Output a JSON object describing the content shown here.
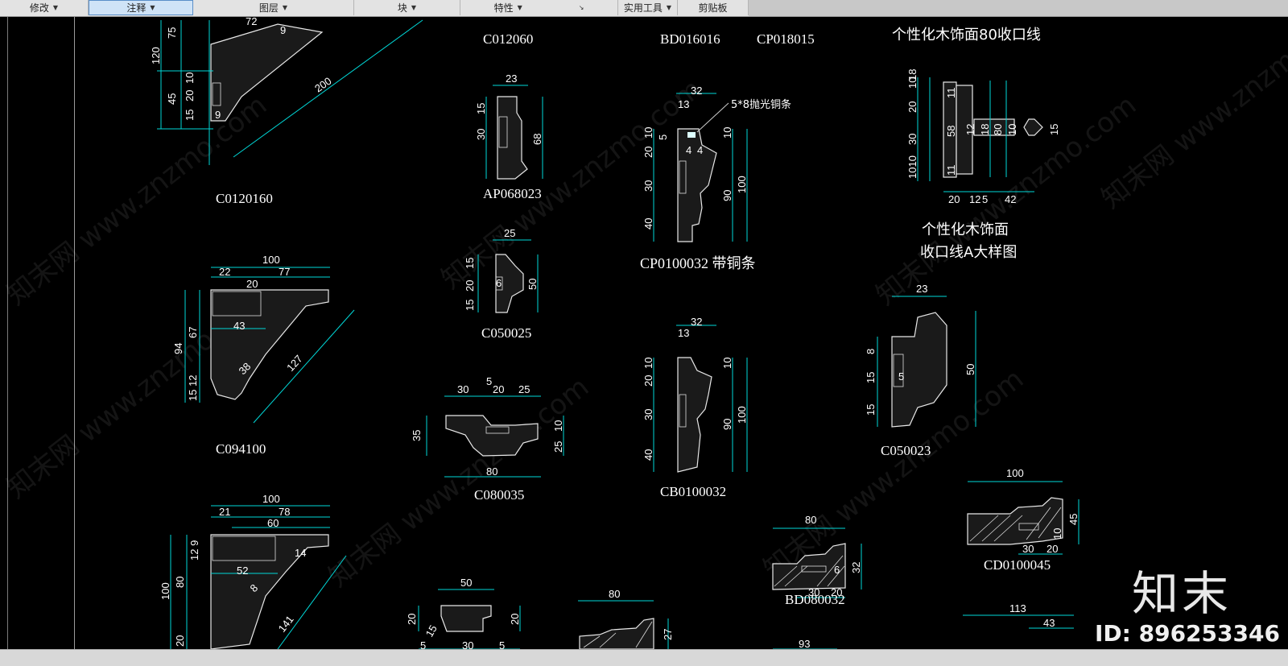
{
  "toolbar": {
    "groups": [
      {
        "label": "修改"
      },
      {
        "label": "注释"
      },
      {
        "label": "图层"
      },
      {
        "label": "块"
      },
      {
        "label": "特性"
      },
      {
        "label": "实用工具"
      },
      {
        "label": "剪贴板"
      }
    ]
  },
  "drawing": {
    "labels": {
      "c0120160": "C0120160",
      "c012060": "C012060",
      "bd016016": "BD016016",
      "cp018015": "CP018015",
      "title_80": "个性化木饰面80收口线",
      "ap068023": "AP068023",
      "cp0100032": "CP0100032 带铜条",
      "note_copper": "5*8抛光铜条",
      "title_a_1": "个性化木饰面",
      "title_a_2": "收口线A大样图",
      "c094100": "C094100",
      "c050025": "C050025",
      "c080035": "C080035",
      "cb0100032": "CB0100032",
      "c050023": "C050023",
      "cd0100045": "CD0100045",
      "bd080032": "BD080032"
    },
    "dimensions": {
      "d75": "75",
      "d72": "72",
      "d9a": "9",
      "d120": "120",
      "d10a": "10",
      "d45": "45",
      "d20a": "20",
      "d15a": "15",
      "d9b": "9",
      "d200": "200",
      "d23a": "23",
      "d15b": "15",
      "d30a": "30",
      "d68": "68",
      "d32a": "32",
      "d13a": "13",
      "d10b": "10",
      "d5a": "5",
      "d20b": "20",
      "d30b": "30",
      "d40a": "40",
      "d4a": "4",
      "d4b": "4",
      "d10c": "10",
      "d90a": "90",
      "d100a": "100",
      "d10d": "10",
      "d18": "18",
      "d20c": "20",
      "d30c": "30",
      "d1010": "1010",
      "d11a": "11",
      "d58": "58",
      "d11b": "11",
      "d12a": "12",
      "d18b": "18",
      "d80a": "80",
      "d10e": "10",
      "d15c": "15",
      "d20d": "20",
      "d12b": "12",
      "d5b": "5",
      "d42": "42",
      "d100b": "100",
      "d22": "22",
      "d77": "77",
      "d20e": "20",
      "d94": "94",
      "d67": "67",
      "d43": "43",
      "d15_12": "15 12",
      "d38": "38",
      "d127": "127",
      "d25a": "25",
      "d15d": "15",
      "d20f": "20",
      "d15e": "15",
      "d6": "6",
      "d50a": "50",
      "d30d": "30",
      "d5c": "5",
      "d20g": "20",
      "d25b": "25",
      "d35": "35",
      "d10f": "10",
      "d25c": "25",
      "d80b": "80",
      "d32b": "32",
      "d13b": "13",
      "d10g": "10",
      "d20h": "20",
      "d30e": "30",
      "d40b": "40",
      "d10h": "10",
      "d90b": "90",
      "d100c": "100",
      "d23b": "23",
      "d8": "8",
      "d15f": "15",
      "d15g": "15",
      "d5d": "5",
      "d50b": "50",
      "d100d": "100",
      "d21": "21",
      "d78": "78",
      "d60": "60",
      "d12_9": "12 9",
      "d14": "14",
      "d52": "52",
      "d8b": "8",
      "d100e": "100",
      "d80c": "80",
      "d20i": "20",
      "d141": "141",
      "d100f": "100",
      "d45b": "45",
      "d30f": "30",
      "d20j": "20",
      "d10i": "10",
      "d80d": "80",
      "d32c": "32",
      "d30g": "30",
      "d20k": "20",
      "d6b": "6",
      "d50c": "50",
      "d20l": "20",
      "d20m": "20",
      "d15h": "15",
      "d30h": "30",
      "d5e": "5",
      "d5f": "5",
      "d80e": "80",
      "d27": "27",
      "d93": "93",
      "d113": "113",
      "d43b": "43"
    },
    "watermark": "知末网 www.znzmo.com"
  },
  "brand": {
    "logo": "知末",
    "id": "ID: 896253346"
  },
  "colors": {
    "background": "#000000",
    "dimension": "#00d8d8",
    "text": "#ffffff",
    "ribbon": "#e3e3e3"
  }
}
